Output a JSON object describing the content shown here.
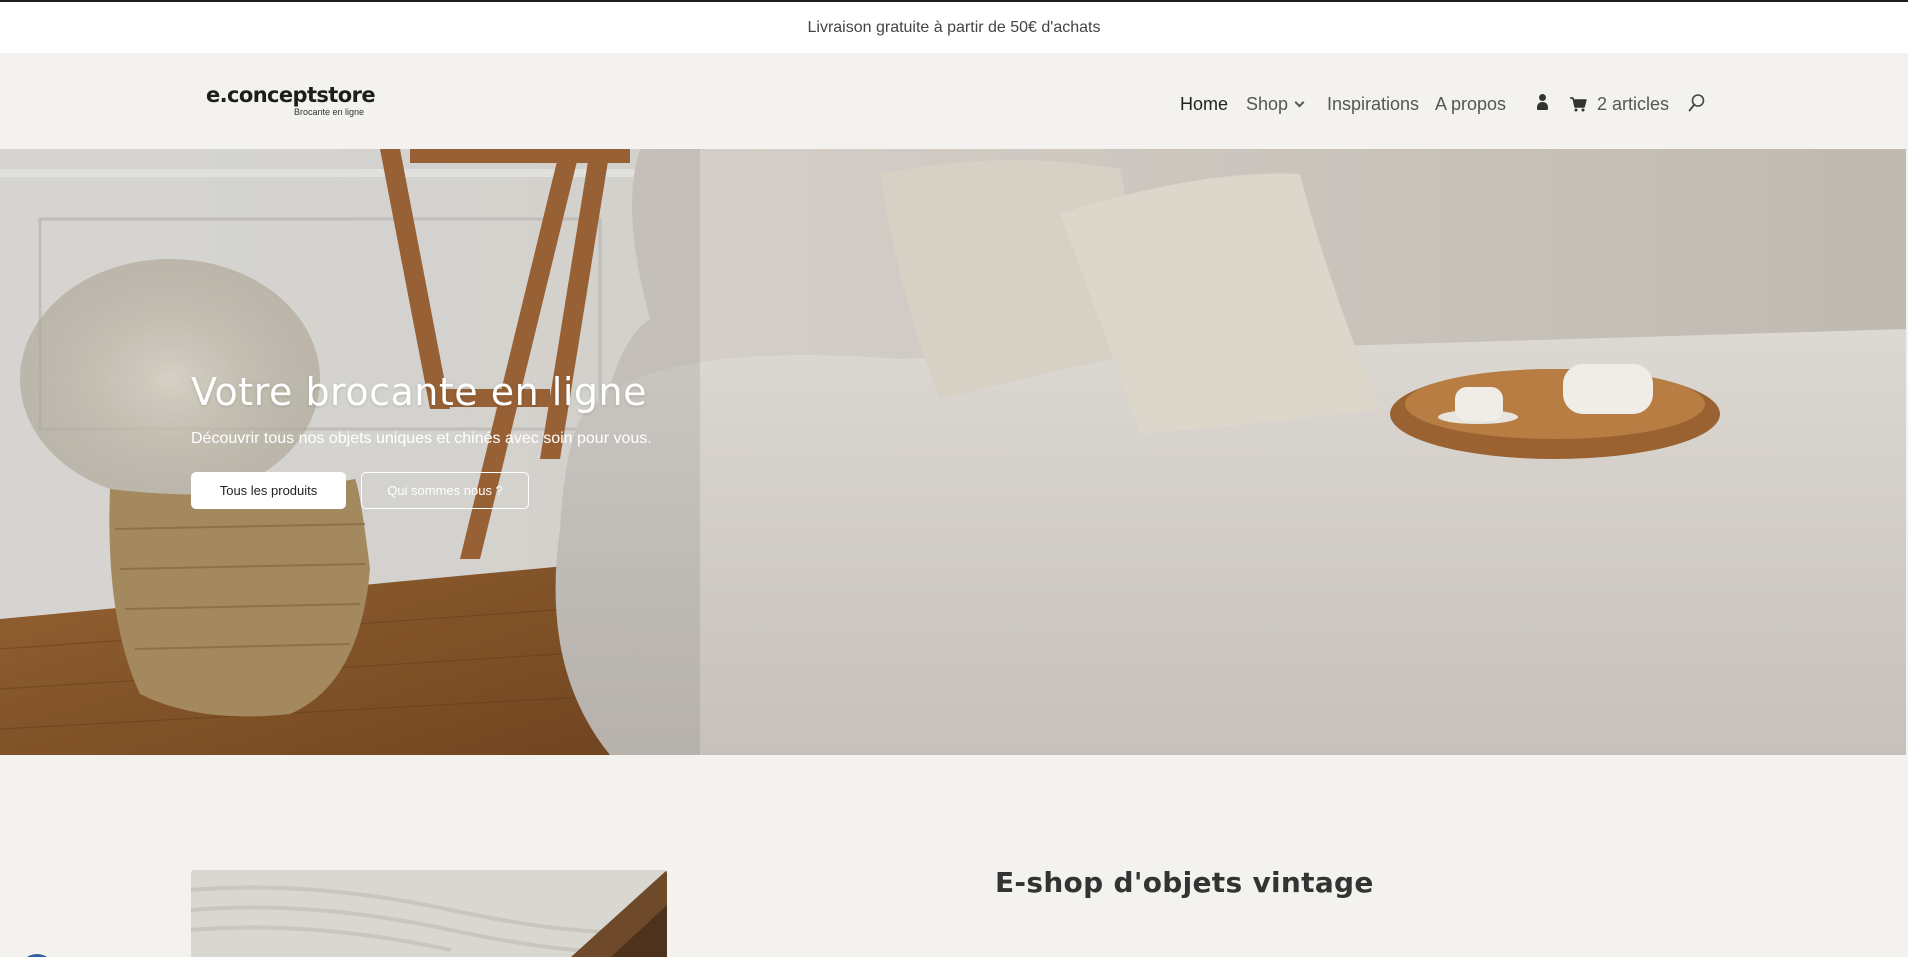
{
  "announcement": {
    "text": "Livraison gratuite à partir de 50€ d'achats"
  },
  "logo": {
    "name": "e.conceptstore",
    "tagline": "Brocante en ligne"
  },
  "nav": {
    "items": [
      {
        "label": "Home",
        "active": true
      },
      {
        "label": "Shop",
        "has_dropdown": true
      },
      {
        "label": "Inspirations"
      },
      {
        "label": "A propos"
      }
    ],
    "account_icon": "user-icon",
    "cart": {
      "icon": "cart-icon",
      "label": "2 articles"
    },
    "search_icon": "search-icon"
  },
  "hero": {
    "title": "Votre brocante en ligne",
    "subtitle": "Découvrir tous nos objets uniques et chinés avec soin pour vous.",
    "primary_button": "Tous les produits",
    "secondary_button": "Qui sommes nous ?"
  },
  "section": {
    "title": "E-shop d'objets vintage"
  },
  "colors": {
    "background": "#f4f2ee",
    "header_bg": "#f4f2ee",
    "announcement_bg": "#ffffff",
    "text_dark": "#222222",
    "button_bg": "#ffffff"
  }
}
